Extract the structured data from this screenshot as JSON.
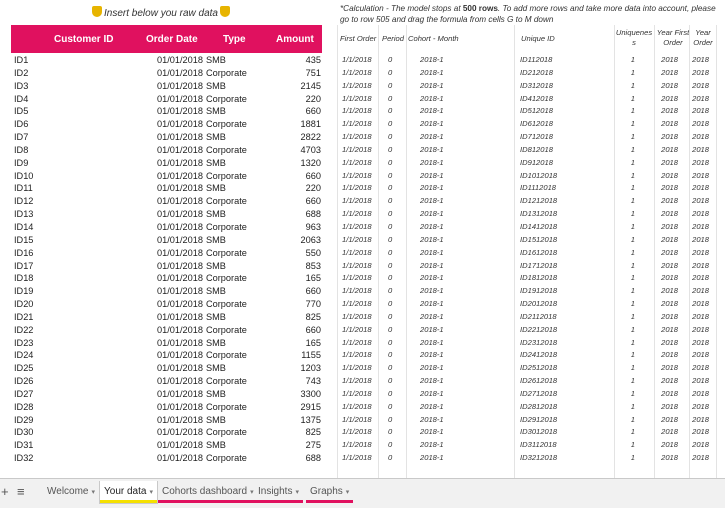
{
  "raw": {
    "note": "Insert below you raw data",
    "headers": {
      "customer_id": "Customer ID",
      "order_date": "Order Date",
      "type": "Type",
      "amount": "Amount"
    },
    "colors": {
      "header_bg": "#e0115f",
      "header_text": "#ffffff"
    }
  },
  "calc": {
    "note_prefix": "*Calculation - The model stops at ",
    "note_bold": "500 rows",
    "note_suffix": ". To add more rows and take more data into account, please go to row 505 and drag the formula from cells G to M down",
    "headers": {
      "first_order": "First Order",
      "period": "Period",
      "cohort": "Cohort - Month",
      "unique_id": "Unique ID",
      "uniqueness": "Uniquenes s",
      "year_first_order": "Year First Order",
      "year_order": "Year Order"
    }
  },
  "rows": [
    {
      "id": "ID1",
      "date": "01/01/2018",
      "type": "SMB",
      "amount": "435",
      "fo": "1/1/2018",
      "period": "0",
      "cohort": "2018-1",
      "uid": "ID112018",
      "uq": "1",
      "yfo": "2018",
      "yo": "2018"
    },
    {
      "id": "ID2",
      "date": "01/01/2018",
      "type": "Corporate",
      "amount": "751",
      "fo": "1/1/2018",
      "period": "0",
      "cohort": "2018-1",
      "uid": "ID212018",
      "uq": "1",
      "yfo": "2018",
      "yo": "2018"
    },
    {
      "id": "ID3",
      "date": "01/01/2018",
      "type": "SMB",
      "amount": "2145",
      "fo": "1/1/2018",
      "period": "0",
      "cohort": "2018-1",
      "uid": "ID312018",
      "uq": "1",
      "yfo": "2018",
      "yo": "2018"
    },
    {
      "id": "ID4",
      "date": "01/01/2018",
      "type": "Corporate",
      "amount": "220",
      "fo": "1/1/2018",
      "period": "0",
      "cohort": "2018-1",
      "uid": "ID412018",
      "uq": "1",
      "yfo": "2018",
      "yo": "2018"
    },
    {
      "id": "ID5",
      "date": "01/01/2018",
      "type": "SMB",
      "amount": "660",
      "fo": "1/1/2018",
      "period": "0",
      "cohort": "2018-1",
      "uid": "ID512018",
      "uq": "1",
      "yfo": "2018",
      "yo": "2018"
    },
    {
      "id": "ID6",
      "date": "01/01/2018",
      "type": "Corporate",
      "amount": "1881",
      "fo": "1/1/2018",
      "period": "0",
      "cohort": "2018-1",
      "uid": "ID612018",
      "uq": "1",
      "yfo": "2018",
      "yo": "2018"
    },
    {
      "id": "ID7",
      "date": "01/01/2018",
      "type": "SMB",
      "amount": "2822",
      "fo": "1/1/2018",
      "period": "0",
      "cohort": "2018-1",
      "uid": "ID712018",
      "uq": "1",
      "yfo": "2018",
      "yo": "2018"
    },
    {
      "id": "ID8",
      "date": "01/01/2018",
      "type": "Corporate",
      "amount": "4703",
      "fo": "1/1/2018",
      "period": "0",
      "cohort": "2018-1",
      "uid": "ID812018",
      "uq": "1",
      "yfo": "2018",
      "yo": "2018"
    },
    {
      "id": "ID9",
      "date": "01/01/2018",
      "type": "SMB",
      "amount": "1320",
      "fo": "1/1/2018",
      "period": "0",
      "cohort": "2018-1",
      "uid": "ID912018",
      "uq": "1",
      "yfo": "2018",
      "yo": "2018"
    },
    {
      "id": "ID10",
      "date": "01/01/2018",
      "type": "Corporate",
      "amount": "660",
      "fo": "1/1/2018",
      "period": "0",
      "cohort": "2018-1",
      "uid": "ID1012018",
      "uq": "1",
      "yfo": "2018",
      "yo": "2018"
    },
    {
      "id": "ID11",
      "date": "01/01/2018",
      "type": "SMB",
      "amount": "220",
      "fo": "1/1/2018",
      "period": "0",
      "cohort": "2018-1",
      "uid": "ID1112018",
      "uq": "1",
      "yfo": "2018",
      "yo": "2018"
    },
    {
      "id": "ID12",
      "date": "01/01/2018",
      "type": "Corporate",
      "amount": "660",
      "fo": "1/1/2018",
      "period": "0",
      "cohort": "2018-1",
      "uid": "ID1212018",
      "uq": "1",
      "yfo": "2018",
      "yo": "2018"
    },
    {
      "id": "ID13",
      "date": "01/01/2018",
      "type": "SMB",
      "amount": "688",
      "fo": "1/1/2018",
      "period": "0",
      "cohort": "2018-1",
      "uid": "ID1312018",
      "uq": "1",
      "yfo": "2018",
      "yo": "2018"
    },
    {
      "id": "ID14",
      "date": "01/01/2018",
      "type": "Corporate",
      "amount": "963",
      "fo": "1/1/2018",
      "period": "0",
      "cohort": "2018-1",
      "uid": "ID1412018",
      "uq": "1",
      "yfo": "2018",
      "yo": "2018"
    },
    {
      "id": "ID15",
      "date": "01/01/2018",
      "type": "SMB",
      "amount": "2063",
      "fo": "1/1/2018",
      "period": "0",
      "cohort": "2018-1",
      "uid": "ID1512018",
      "uq": "1",
      "yfo": "2018",
      "yo": "2018"
    },
    {
      "id": "ID16",
      "date": "01/01/2018",
      "type": "Corporate",
      "amount": "550",
      "fo": "1/1/2018",
      "period": "0",
      "cohort": "2018-1",
      "uid": "ID1612018",
      "uq": "1",
      "yfo": "2018",
      "yo": "2018"
    },
    {
      "id": "ID17",
      "date": "01/01/2018",
      "type": "SMB",
      "amount": "853",
      "fo": "1/1/2018",
      "period": "0",
      "cohort": "2018-1",
      "uid": "ID1712018",
      "uq": "1",
      "yfo": "2018",
      "yo": "2018"
    },
    {
      "id": "ID18",
      "date": "01/01/2018",
      "type": "Corporate",
      "amount": "165",
      "fo": "1/1/2018",
      "period": "0",
      "cohort": "2018-1",
      "uid": "ID1812018",
      "uq": "1",
      "yfo": "2018",
      "yo": "2018"
    },
    {
      "id": "ID19",
      "date": "01/01/2018",
      "type": "SMB",
      "amount": "660",
      "fo": "1/1/2018",
      "period": "0",
      "cohort": "2018-1",
      "uid": "ID1912018",
      "uq": "1",
      "yfo": "2018",
      "yo": "2018"
    },
    {
      "id": "ID20",
      "date": "01/01/2018",
      "type": "Corporate",
      "amount": "770",
      "fo": "1/1/2018",
      "period": "0",
      "cohort": "2018-1",
      "uid": "ID2012018",
      "uq": "1",
      "yfo": "2018",
      "yo": "2018"
    },
    {
      "id": "ID21",
      "date": "01/01/2018",
      "type": "SMB",
      "amount": "825",
      "fo": "1/1/2018",
      "period": "0",
      "cohort": "2018-1",
      "uid": "ID2112018",
      "uq": "1",
      "yfo": "2018",
      "yo": "2018"
    },
    {
      "id": "ID22",
      "date": "01/01/2018",
      "type": "Corporate",
      "amount": "660",
      "fo": "1/1/2018",
      "period": "0",
      "cohort": "2018-1",
      "uid": "ID2212018",
      "uq": "1",
      "yfo": "2018",
      "yo": "2018"
    },
    {
      "id": "ID23",
      "date": "01/01/2018",
      "type": "SMB",
      "amount": "165",
      "fo": "1/1/2018",
      "period": "0",
      "cohort": "2018-1",
      "uid": "ID2312018",
      "uq": "1",
      "yfo": "2018",
      "yo": "2018"
    },
    {
      "id": "ID24",
      "date": "01/01/2018",
      "type": "Corporate",
      "amount": "1155",
      "fo": "1/1/2018",
      "period": "0",
      "cohort": "2018-1",
      "uid": "ID2412018",
      "uq": "1",
      "yfo": "2018",
      "yo": "2018"
    },
    {
      "id": "ID25",
      "date": "01/01/2018",
      "type": "SMB",
      "amount": "1203",
      "fo": "1/1/2018",
      "period": "0",
      "cohort": "2018-1",
      "uid": "ID2512018",
      "uq": "1",
      "yfo": "2018",
      "yo": "2018"
    },
    {
      "id": "ID26",
      "date": "01/01/2018",
      "type": "Corporate",
      "amount": "743",
      "fo": "1/1/2018",
      "period": "0",
      "cohort": "2018-1",
      "uid": "ID2612018",
      "uq": "1",
      "yfo": "2018",
      "yo": "2018"
    },
    {
      "id": "ID27",
      "date": "01/01/2018",
      "type": "SMB",
      "amount": "3300",
      "fo": "1/1/2018",
      "period": "0",
      "cohort": "2018-1",
      "uid": "ID2712018",
      "uq": "1",
      "yfo": "2018",
      "yo": "2018"
    },
    {
      "id": "ID28",
      "date": "01/01/2018",
      "type": "Corporate",
      "amount": "2915",
      "fo": "1/1/2018",
      "period": "0",
      "cohort": "2018-1",
      "uid": "ID2812018",
      "uq": "1",
      "yfo": "2018",
      "yo": "2018"
    },
    {
      "id": "ID29",
      "date": "01/01/2018",
      "type": "SMB",
      "amount": "1375",
      "fo": "1/1/2018",
      "period": "0",
      "cohort": "2018-1",
      "uid": "ID2912018",
      "uq": "1",
      "yfo": "2018",
      "yo": "2018"
    },
    {
      "id": "ID30",
      "date": "01/01/2018",
      "type": "Corporate",
      "amount": "825",
      "fo": "1/1/2018",
      "period": "0",
      "cohort": "2018-1",
      "uid": "ID3012018",
      "uq": "1",
      "yfo": "2018",
      "yo": "2018"
    },
    {
      "id": "ID31",
      "date": "01/01/2018",
      "type": "SMB",
      "amount": "275",
      "fo": "1/1/2018",
      "period": "0",
      "cohort": "2018-1",
      "uid": "ID3112018",
      "uq": "1",
      "yfo": "2018",
      "yo": "2018"
    },
    {
      "id": "ID32",
      "date": "01/01/2018",
      "type": "Corporate",
      "amount": "688",
      "fo": "1/1/2018",
      "period": "0",
      "cohort": "2018-1",
      "uid": "ID3212018",
      "uq": "1",
      "yfo": "2018",
      "yo": "2018"
    }
  ],
  "tabbar": {
    "add_icon": "+",
    "menu_icon": "≡",
    "tabs": [
      {
        "label": "Welcome",
        "arrow": "▾",
        "color": ""
      },
      {
        "label": "Your data",
        "arrow": "▾",
        "color": "#f5e000",
        "active": true
      },
      {
        "label": "Cohorts dashboard",
        "arrow": "▾",
        "color": "#e0115f"
      },
      {
        "label": "Insights",
        "arrow": "▾",
        "color": "#e0115f"
      },
      {
        "label": "Graphs",
        "arrow": "▾",
        "color": "#e0115f"
      }
    ]
  }
}
